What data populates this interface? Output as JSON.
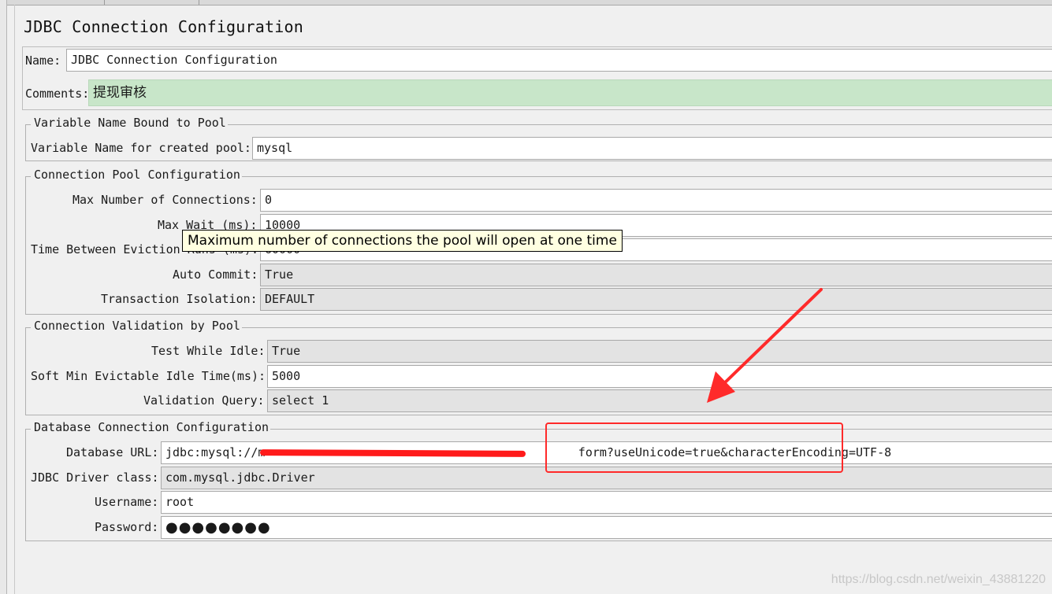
{
  "window": {
    "title": "JDBC Connection Configuration"
  },
  "name_field": {
    "label": "Name:",
    "value": "JDBC Connection Configuration"
  },
  "comments_field": {
    "label": "Comments:",
    "value": "提现审核"
  },
  "variable_pool": {
    "legend": "Variable Name Bound to Pool",
    "label": "Variable Name for created pool:",
    "value": "mysql"
  },
  "connection_pool": {
    "legend": "Connection Pool Configuration",
    "max_connections": {
      "label": "Max Number of Connections:",
      "value": "0"
    },
    "max_wait": {
      "label": "Max Wait (ms):",
      "value": "10000"
    },
    "eviction_runs": {
      "label": "Time Between Eviction Runs (ms):",
      "value": "60000"
    },
    "auto_commit": {
      "label": "Auto Commit:",
      "value": "True"
    },
    "transaction_isolation": {
      "label": "Transaction Isolation:",
      "value": "DEFAULT"
    }
  },
  "tooltip": {
    "text": "Maximum number of connections the pool will open at one time"
  },
  "validation": {
    "legend": "Connection Validation by Pool",
    "test_while_idle": {
      "label": "Test While Idle:",
      "value": "True"
    },
    "soft_min_evictable": {
      "label": "Soft Min Evictable Idle Time(ms):",
      "value": "5000"
    },
    "validation_query": {
      "label": "Validation Query:",
      "value": "select 1"
    }
  },
  "database": {
    "legend": "Database Connection Configuration",
    "url": {
      "label": "Database URL:",
      "value": "jdbc:mysql://m                                            form?useUnicode=true&characterEncoding=UTF-8"
    },
    "driver": {
      "label": "JDBC Driver class:",
      "value": "com.mysql.jdbc.Driver"
    },
    "username": {
      "label": "Username:",
      "value": "root"
    },
    "password": {
      "label": "Password:",
      "value": "●●●●●●●●"
    }
  },
  "watermark": "https://blog.csdn.net/weixin_43881220",
  "colors": {
    "comments_bg": "#c8e6c9",
    "annotation_red": "#ff2a2a",
    "tooltip_bg": "#ffffe1"
  }
}
